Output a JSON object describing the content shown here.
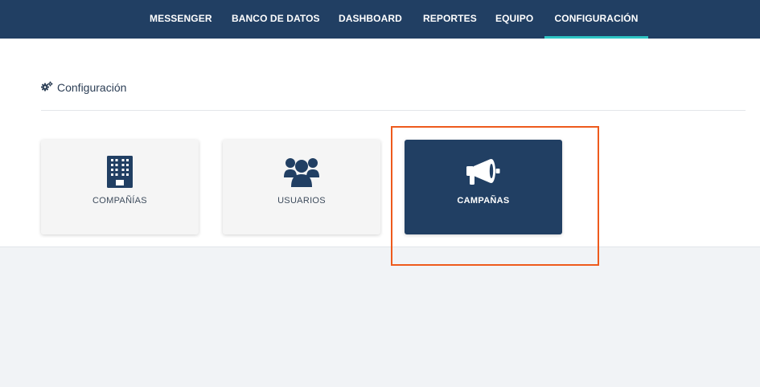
{
  "nav": {
    "items": [
      {
        "label": "MESSENGER",
        "active": false
      },
      {
        "label": "BANCO DE DATOS",
        "active": false
      },
      {
        "label": "DASHBOARD",
        "active": false
      },
      {
        "label": "REPORTES",
        "active": false
      },
      {
        "label": "EQUIPO",
        "active": false
      },
      {
        "label": "CONFIGURACIÓN",
        "active": true
      }
    ]
  },
  "page": {
    "title": "Configuración",
    "title_icon": "gears-icon"
  },
  "cards": [
    {
      "label": "COMPAÑÍAS",
      "icon": "building-icon",
      "selected": false
    },
    {
      "label": "USUARIOS",
      "icon": "users-icon",
      "selected": false
    },
    {
      "label": "CAMPAÑAS",
      "icon": "megaphone-icon",
      "selected": true
    }
  ],
  "colors": {
    "nav_bg": "#213f63",
    "active_underline": "#2ec5c5",
    "card_selected_bg": "#213f63",
    "highlight_border": "#ee5a1c"
  }
}
